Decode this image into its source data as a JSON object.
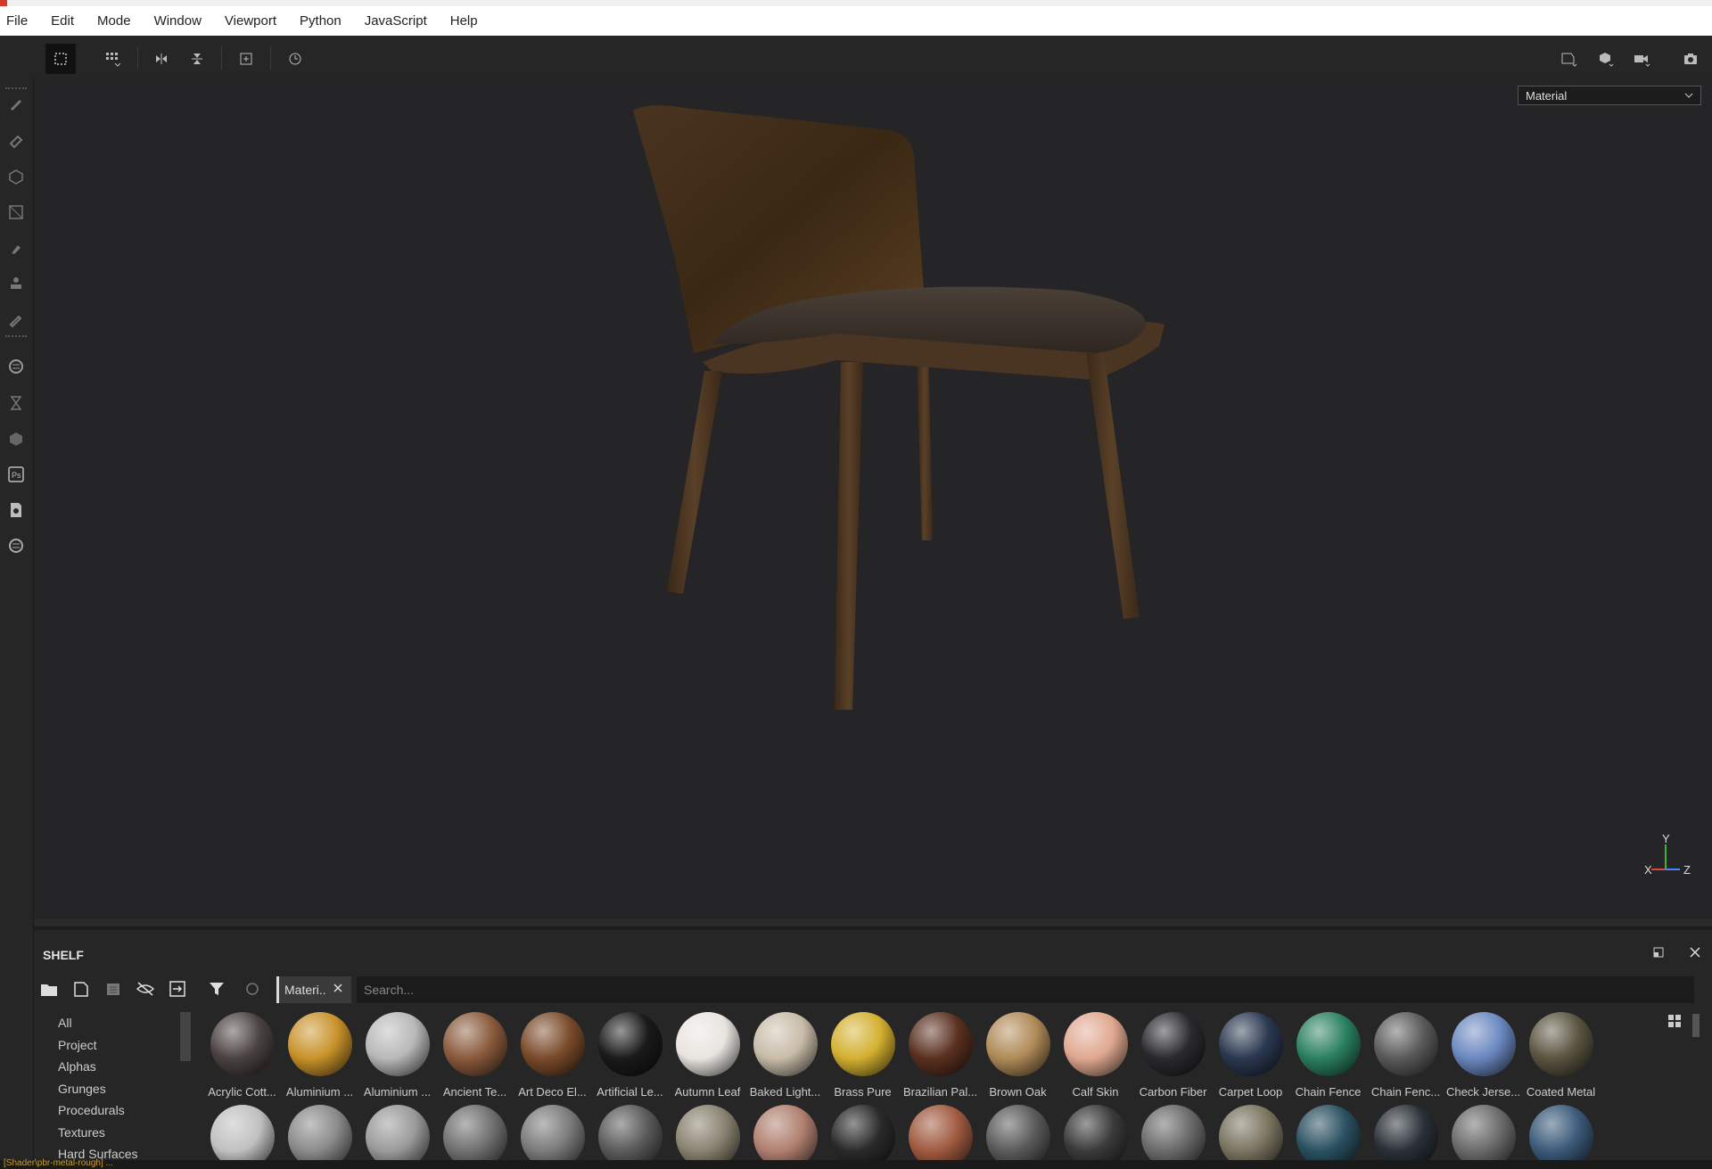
{
  "menu": [
    "File",
    "Edit",
    "Mode",
    "Window",
    "Viewport",
    "Python",
    "JavaScript",
    "Help"
  ],
  "viewport": {
    "channel_select": "Material",
    "gizmo": {
      "y": "Y",
      "x": "X",
      "z": "Z"
    }
  },
  "shelf": {
    "title": "SHELF",
    "filter_chip": "Materi..",
    "search_placeholder": "Search...",
    "categories": [
      "All",
      "Project",
      "Alphas",
      "Grunges",
      "Procedurals",
      "Textures",
      "Hard Surfaces"
    ],
    "materials_row1": [
      {
        "label": "Acrylic Cott...",
        "color": "#4a4240"
      },
      {
        "label": "Aluminium ...",
        "color": "#c8922a"
      },
      {
        "label": "Aluminium ...",
        "color": "#b8b8b8"
      },
      {
        "label": "Ancient Te...",
        "color": "#8a5a3c"
      },
      {
        "label": "Art Deco El...",
        "color": "#7a4a2a"
      },
      {
        "label": "Artificial Le...",
        "color": "#1a1a1a"
      },
      {
        "label": "Autumn Leaf",
        "color": "#e8e4e0"
      },
      {
        "label": "Baked Light...",
        "color": "#c8bca8"
      },
      {
        "label": "Brass Pure",
        "color": "#d4b030"
      },
      {
        "label": "Brazilian Pal...",
        "color": "#5a3020"
      },
      {
        "label": "Brown Oak",
        "color": "#b08a58"
      },
      {
        "label": "Calf Skin",
        "color": "#e0a890"
      },
      {
        "label": "Carbon Fiber",
        "color": "#2a2a2e"
      },
      {
        "label": "Carpet Loop",
        "color": "#2a3850"
      },
      {
        "label": "Chain Fence",
        "color": "#2a8060"
      },
      {
        "label": "Chain Fenc...",
        "color": "#5a5a5a"
      },
      {
        "label": "Check Jerse...",
        "color": "#6a88c0"
      },
      {
        "label": "Coated Metal",
        "color": "#5a5440"
      }
    ],
    "materials_row2_colors": [
      "#c0c0c0",
      "#8a8a8a",
      "#9a9a9a",
      "#707070",
      "#7a7a7a",
      "#5a5a5a",
      "#8a8270",
      "#b08070",
      "#2a2a2a",
      "#a05a40",
      "#5a5a5a",
      "#3a3a3a",
      "#6a6a6a",
      "#7a7460",
      "#2a5060",
      "#2a3038",
      "#6a6a6a",
      "#3a5a78"
    ]
  },
  "status": "[Shader\\pbr-metal-rough] ..."
}
